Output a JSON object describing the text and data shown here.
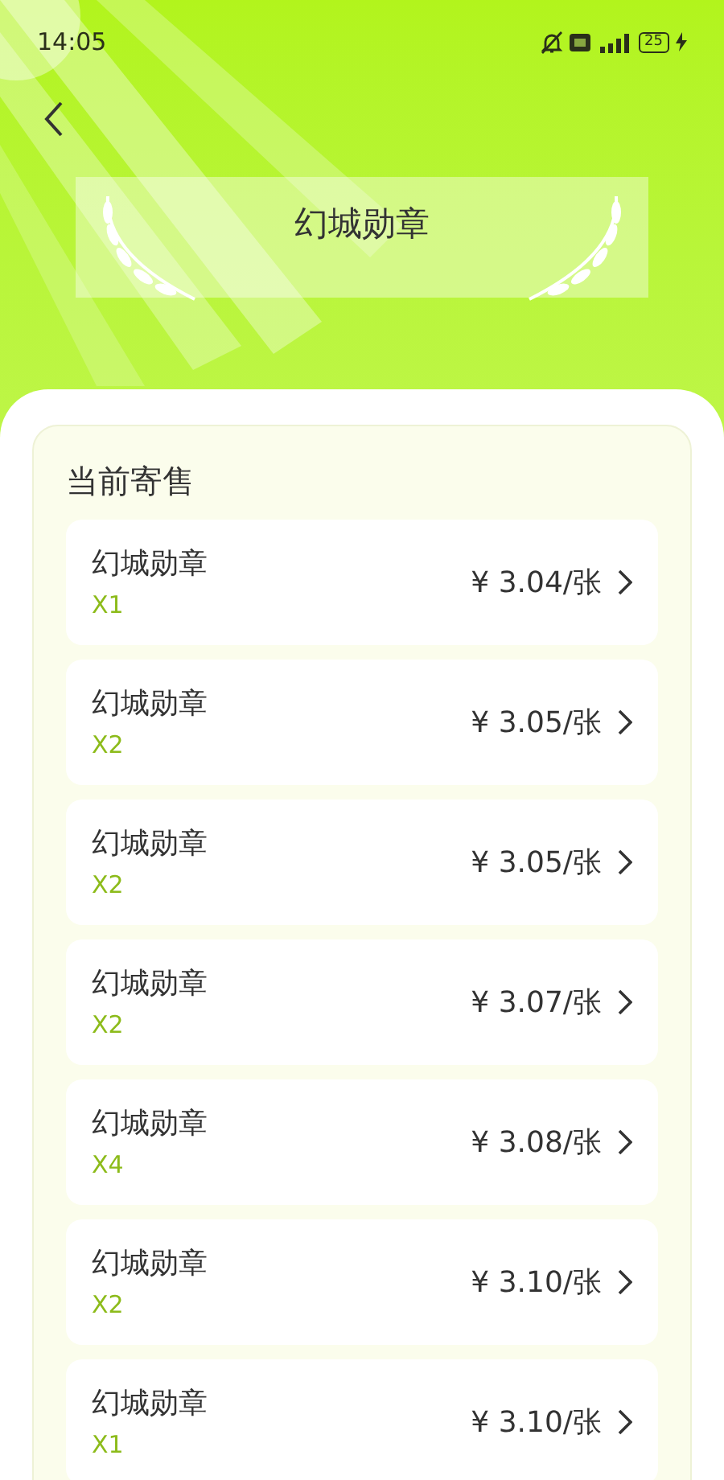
{
  "status_bar": {
    "time": "14:05",
    "battery": "25"
  },
  "header": {
    "title": "幻城勋章"
  },
  "section": {
    "title": "当前寄售",
    "listings": [
      {
        "name": "幻城勋章",
        "quantity": "X1",
        "price": "¥ 3.04/张"
      },
      {
        "name": "幻城勋章",
        "quantity": "X2",
        "price": "¥ 3.05/张"
      },
      {
        "name": "幻城勋章",
        "quantity": "X2",
        "price": "¥ 3.05/张"
      },
      {
        "name": "幻城勋章",
        "quantity": "X2",
        "price": "¥ 3.07/张"
      },
      {
        "name": "幻城勋章",
        "quantity": "X4",
        "price": "¥ 3.08/张"
      },
      {
        "name": "幻城勋章",
        "quantity": "X2",
        "price": "¥ 3.10/张"
      },
      {
        "name": "幻城勋章",
        "quantity": "X1",
        "price": "¥ 3.10/张"
      }
    ]
  }
}
